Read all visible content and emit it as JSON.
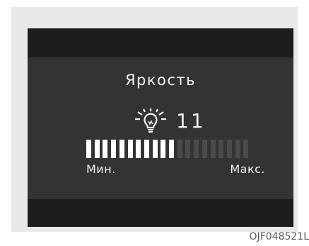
{
  "screen": {
    "title": "Яркость",
    "icon": "bulb-brightness-icon",
    "level": {
      "value": "11",
      "current": 11,
      "max": 20
    },
    "scale": {
      "min_label": "Мин.",
      "max_label": "Макс."
    }
  },
  "figure_code": "OJF048521L",
  "colors": {
    "screen_bg": "#333333",
    "band_bg": "#1d1d1d",
    "segment_on": "#ffffff",
    "segment_off": "#4a4a4a",
    "frame_bg": "#e9e9e9"
  }
}
